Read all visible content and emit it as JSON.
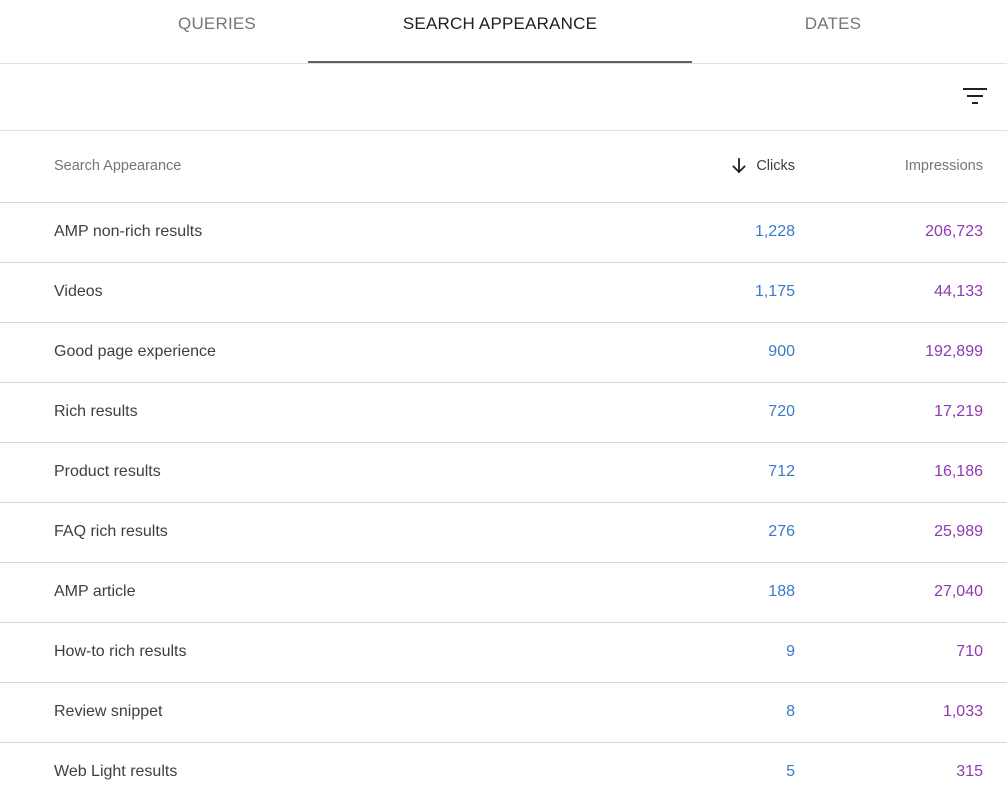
{
  "tabs": [
    {
      "label": "QUERIES",
      "active": false
    },
    {
      "label": "SEARCH APPEARANCE",
      "active": true
    },
    {
      "label": "DATES",
      "active": false
    }
  ],
  "toolbar": {
    "filter_icon": "filter-list-icon"
  },
  "table": {
    "headers": {
      "name": "Search Appearance",
      "clicks": "Clicks",
      "impressions": "Impressions",
      "sort_icon": "arrow-down-icon"
    },
    "rows": [
      {
        "name": "AMP non-rich results",
        "clicks": "1,228",
        "impressions": "206,723"
      },
      {
        "name": "Videos",
        "clicks": "1,175",
        "impressions": "44,133"
      },
      {
        "name": "Good page experience",
        "clicks": "900",
        "impressions": "192,899"
      },
      {
        "name": "Rich results",
        "clicks": "720",
        "impressions": "17,219"
      },
      {
        "name": "Product results",
        "clicks": "712",
        "impressions": "16,186"
      },
      {
        "name": "FAQ rich results",
        "clicks": "276",
        "impressions": "25,989"
      },
      {
        "name": "AMP article",
        "clicks": "188",
        "impressions": "27,040"
      },
      {
        "name": "How-to rich results",
        "clicks": "9",
        "impressions": "710"
      },
      {
        "name": "Review snippet",
        "clicks": "8",
        "impressions": "1,033"
      },
      {
        "name": "Web Light results",
        "clicks": "5",
        "impressions": "315"
      }
    ]
  },
  "colors": {
    "clicks": "#3b7ac8",
    "impressions": "#8e3ab1",
    "active_tab_indicator": "#616161"
  }
}
